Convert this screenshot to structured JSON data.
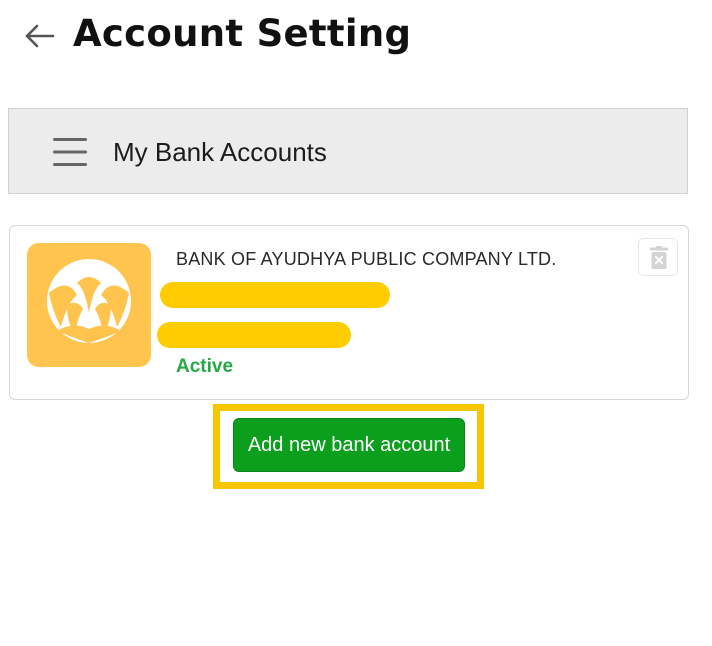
{
  "header": {
    "title": "Account Setting",
    "back_icon": "arrow-left-icon"
  },
  "section": {
    "menu_icon": "hamburger-menu-icon",
    "title": "My Bank Accounts"
  },
  "bank_accounts": [
    {
      "bank_name": "BANK OF AYUDHYA PUBLIC COMPANY LTD.",
      "logo_icon": "krungsri-bank-logo",
      "logo_color": "#fec44e",
      "status": "Active",
      "status_color": "#27a844",
      "delete_icon": "trash-icon"
    }
  ],
  "actions": {
    "add_label": "Add new bank account",
    "add_color": "#0c9f1e"
  },
  "colors": {
    "highlight": "#f7c600",
    "redaction": "#ffcc00",
    "section_bg": "#ececec"
  }
}
